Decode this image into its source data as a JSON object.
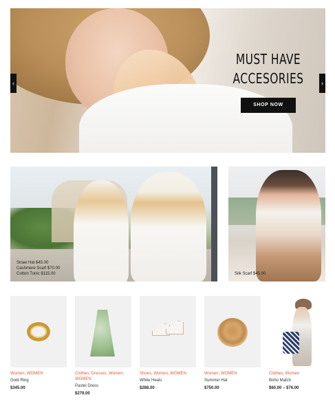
{
  "hero": {
    "title_line1": "MUST HAVE",
    "title_line2": "ACCESORIES",
    "button_label": "SHOP NOW",
    "prev_arrow": "‹",
    "next_arrow": "›"
  },
  "banners": [
    {
      "captions": [
        "Straw Hat $45.00",
        "Cashmere Scarf $70.00",
        "Cotton Tunic $115.00"
      ]
    },
    {
      "captions": [
        "Silk Scarf $45.00"
      ]
    }
  ],
  "products": [
    {
      "categories": "Women, WOMEN",
      "name": "Gold Ring",
      "price": "$345.00",
      "image": "gold-ring"
    },
    {
      "categories": "Clothes, Dresses, Women, WOMEN",
      "name": "Pastel Dress",
      "price": "$279.00",
      "image": "pastel-dress"
    },
    {
      "categories": "Shoes, Women, WOMEN",
      "name": "White Heals",
      "price": "$288.00",
      "image": "white-heels"
    },
    {
      "categories": "Women, WOMEN",
      "name": "Summer Hat",
      "price": "$750.00",
      "image": "summer-hat"
    },
    {
      "categories": "Clothes, Women",
      "name": "Boho Match",
      "price": "$60.00 – $76.00",
      "image": "boho-outfit"
    }
  ],
  "colors": {
    "accent": "#e05a3a",
    "button_bg": "#111111",
    "product_bg": "#f1f1f1"
  }
}
